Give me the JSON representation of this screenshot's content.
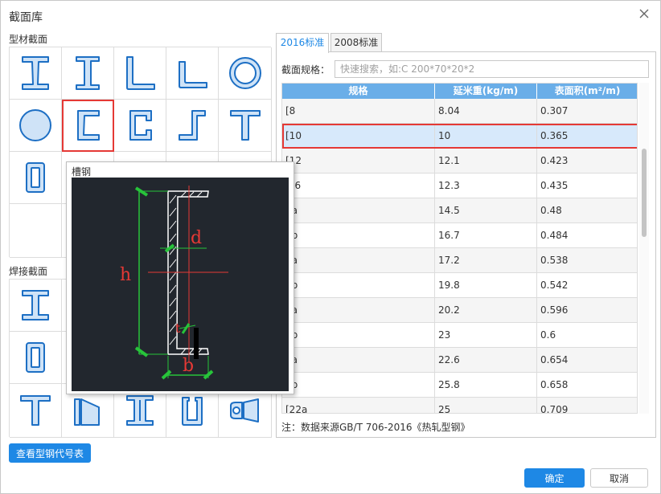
{
  "dialog": {
    "title": "截面库"
  },
  "left": {
    "section_profile": "型材截面",
    "section_welded": "焊接截面",
    "code_table_button": "查看型钢代号表"
  },
  "tooltip": {
    "title": "槽钢",
    "dim_h": "h",
    "dim_b": "b",
    "dim_d": "d",
    "dim_t": "t"
  },
  "tabs": [
    {
      "label": "2016标准",
      "active": true
    },
    {
      "label": "2008标准",
      "active": false
    }
  ],
  "search": {
    "label": "截面规格：",
    "placeholder": "快速搜索，如:C 200*70*20*2"
  },
  "table": {
    "headers": [
      "规格",
      "延米重(kg/m)",
      "表面积(m²/m)"
    ],
    "rows": [
      [
        "[8",
        "8.04",
        "0.307"
      ],
      [
        "[10",
        "10",
        "0.365"
      ],
      [
        "[12",
        "12.1",
        "0.423"
      ],
      [
        "2.6",
        "12.3",
        "0.435"
      ],
      [
        "4a",
        "14.5",
        "0.48"
      ],
      [
        "4b",
        "16.7",
        "0.484"
      ],
      [
        "6a",
        "17.2",
        "0.538"
      ],
      [
        "6b",
        "19.8",
        "0.542"
      ],
      [
        "8a",
        "20.2",
        "0.596"
      ],
      [
        "8b",
        "23",
        "0.6"
      ],
      [
        "0a",
        "22.6",
        "0.654"
      ],
      [
        "0b",
        "25.8",
        "0.658"
      ],
      [
        "[22a",
        "25",
        "0.709"
      ]
    ],
    "selected_index": 1
  },
  "note": "注：数据来源GB/T 706-2016《热轧型钢》",
  "footer": {
    "ok": "确定",
    "cancel": "取消"
  },
  "colors": {
    "accent": "#1e88e5",
    "selection_border": "#e53935",
    "header_bg": "#6aaee8",
    "icon_fill": "#cfe3f7",
    "icon_stroke": "#1d6fc4"
  }
}
